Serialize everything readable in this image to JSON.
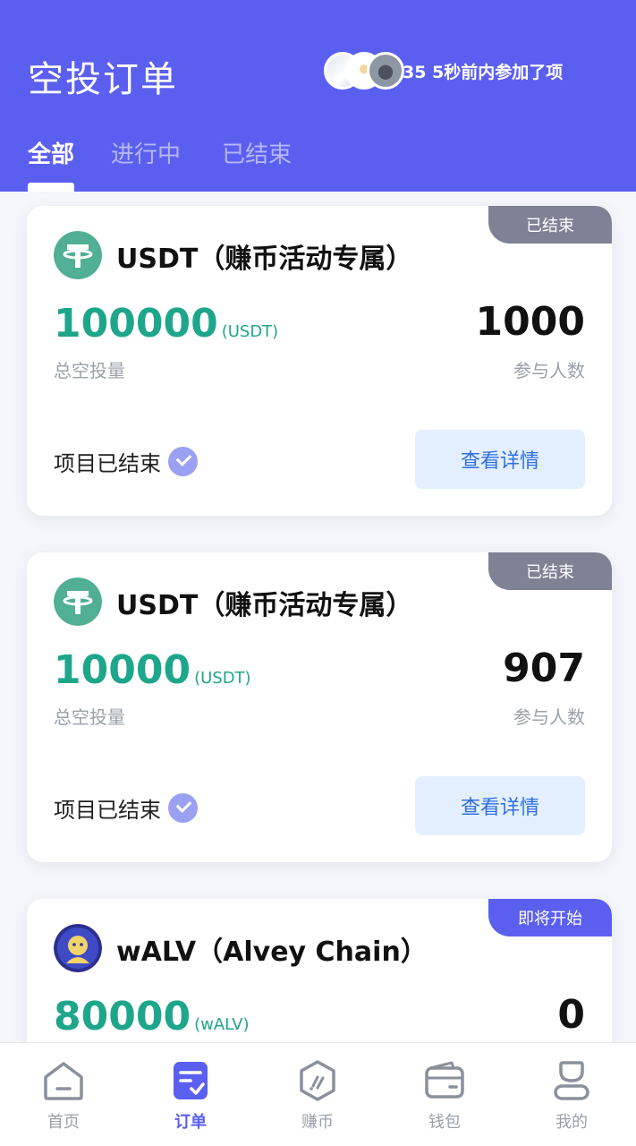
{
  "header": {
    "title": "空投订单",
    "ticker_text": "35 5秒前内参加了项"
  },
  "tabs": [
    {
      "label": "全部",
      "active": true
    },
    {
      "label": "进行中",
      "active": false
    },
    {
      "label": "已结束",
      "active": false
    }
  ],
  "cards": [
    {
      "badge": "已结束",
      "token_name": "USDT（赚币活动专属）",
      "amount": "100000",
      "unit": "(USDT)",
      "amount_label": "总空投量",
      "participants": "1000",
      "participants_label": "参与人数",
      "status_text": "项目已结束",
      "button_label": "查看详情"
    },
    {
      "badge": "已结束",
      "token_name": "USDT（赚币活动专属）",
      "amount": "10000",
      "unit": "(USDT)",
      "amount_label": "总空投量",
      "participants": "907",
      "participants_label": "参与人数",
      "status_text": "项目已结束",
      "button_label": "查看详情"
    },
    {
      "badge": "即将开始",
      "token_name": "wALV（Alvey Chain）",
      "amount": "80000",
      "unit": "(wALV)",
      "participants": "0"
    }
  ],
  "bottom_nav": [
    {
      "label": "首页",
      "icon": "home-icon",
      "active": false
    },
    {
      "label": "订单",
      "icon": "order-icon",
      "active": true
    },
    {
      "label": "赚币",
      "icon": "earn-icon",
      "active": false
    },
    {
      "label": "钱包",
      "icon": "wallet-icon",
      "active": false
    },
    {
      "label": "我的",
      "icon": "profile-icon",
      "active": false
    }
  ],
  "colors": {
    "brand": "#5b5ff0",
    "amount_green": "#1ea68a",
    "badge_ended": "#7e8294",
    "tether_green": "#50af95"
  }
}
